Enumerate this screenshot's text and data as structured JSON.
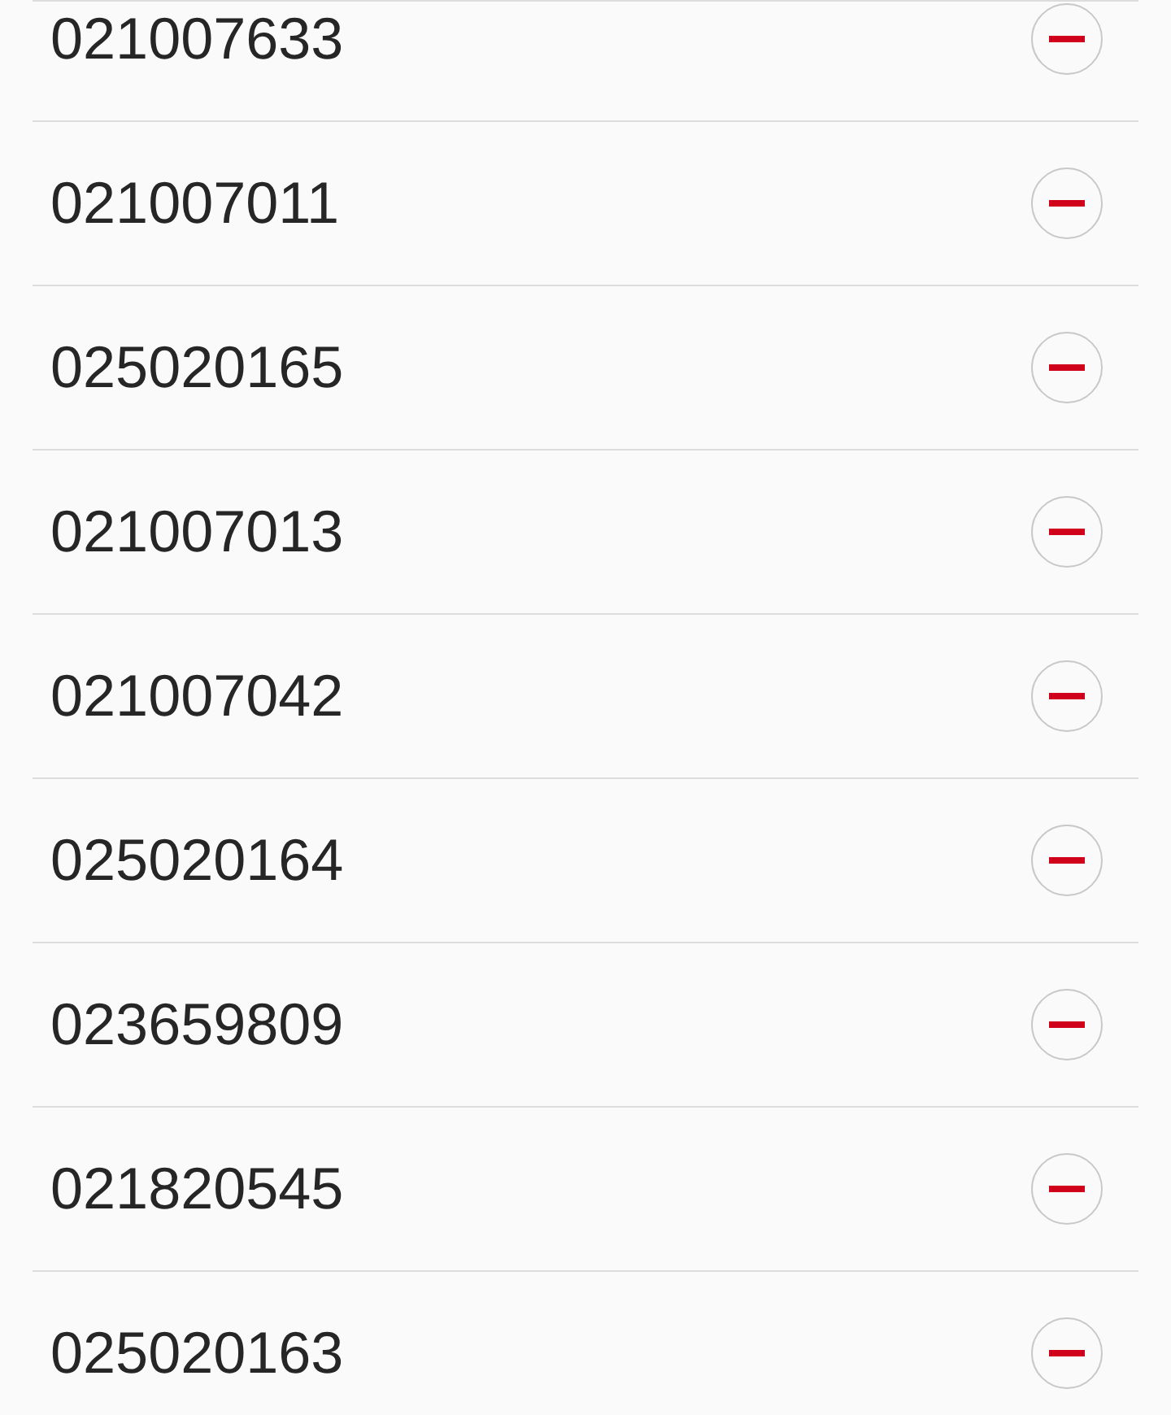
{
  "numbers": [
    {
      "number": "021007633"
    },
    {
      "number": "021007011"
    },
    {
      "number": "025020165"
    },
    {
      "number": "021007013"
    },
    {
      "number": "021007042"
    },
    {
      "number": "025020164"
    },
    {
      "number": "023659809"
    },
    {
      "number": "021820545"
    },
    {
      "number": "025020163"
    }
  ]
}
